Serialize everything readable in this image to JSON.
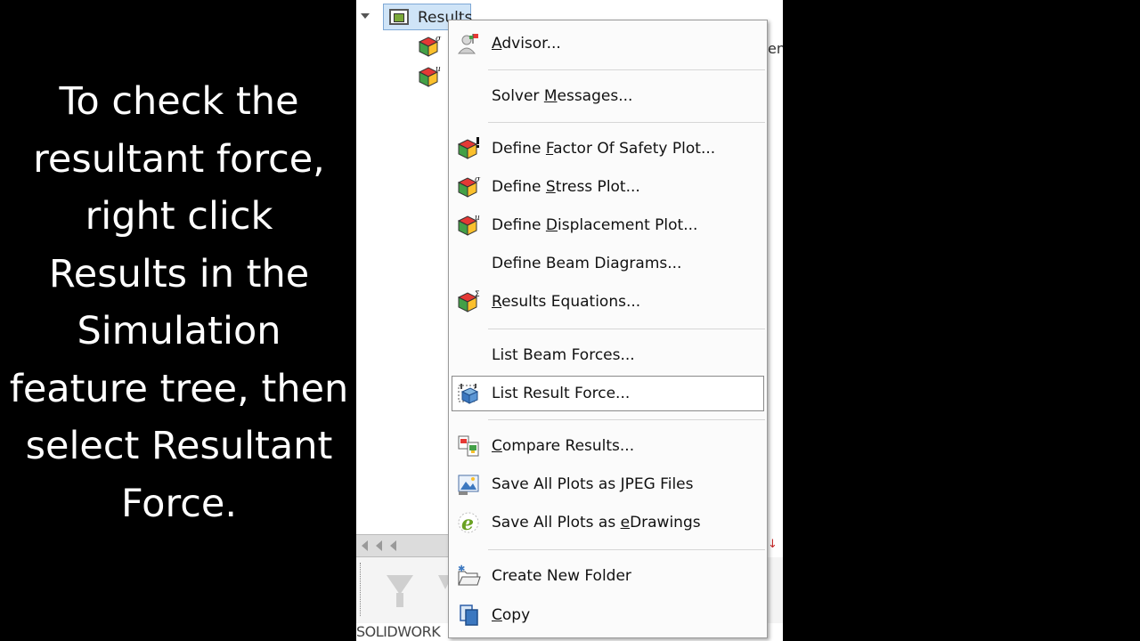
{
  "caption": {
    "lines": [
      "To check the",
      "resultant force,",
      "right click",
      "Results in the",
      "Simulation",
      "feature tree, then",
      "select Resultant",
      "Force."
    ]
  },
  "tree": {
    "results_label": "Results",
    "right_fragment": "en",
    "bottom_label": "SOLIDWORK"
  },
  "menu": {
    "items": [
      {
        "pre": "",
        "key": "A",
        "post": "dvisor...",
        "icon": "advisor-icon"
      },
      {
        "pre": "Solver ",
        "key": "M",
        "post": "essages...",
        "icon": ""
      },
      {
        "pre": "Define ",
        "key": "F",
        "post": "actor Of Safety Plot...",
        "icon": "factor-of-safety-plot-icon"
      },
      {
        "pre": "Define ",
        "key": "S",
        "post": "tress Plot...",
        "icon": "stress-plot-icon"
      },
      {
        "pre": "Define ",
        "key": "D",
        "post": "isplacement Plot...",
        "icon": "displacement-plot-icon"
      },
      {
        "pre": "Define Beam Diagrams...",
        "key": "",
        "post": "",
        "icon": ""
      },
      {
        "pre": "",
        "key": "R",
        "post": "esults Equations...",
        "icon": "results-equations-icon"
      },
      {
        "pre": "List Beam Forces...",
        "key": "",
        "post": "",
        "icon": ""
      },
      {
        "pre": "List Result Force...",
        "key": "",
        "post": "",
        "icon": "list-result-force-icon"
      },
      {
        "pre": "",
        "key": "C",
        "post": "ompare Results...",
        "icon": "compare-results-icon"
      },
      {
        "pre": "Save All Plots as ",
        "key": "J",
        "post": "PEG Files",
        "icon": "save-jpeg-icon"
      },
      {
        "pre": "Save All Plots as ",
        "key": "e",
        "post": "Drawings",
        "icon": "save-edrawings-icon"
      },
      {
        "pre": "Create New Folder",
        "key": "",
        "post": "",
        "icon": "create-folder-icon"
      },
      {
        "pre": "",
        "key": "C",
        "post": "opy",
        "icon": "copy-icon"
      }
    ]
  },
  "colors": {
    "highlight_border": "#8a8a8a",
    "results_node_bg": "#cfe4f7"
  }
}
